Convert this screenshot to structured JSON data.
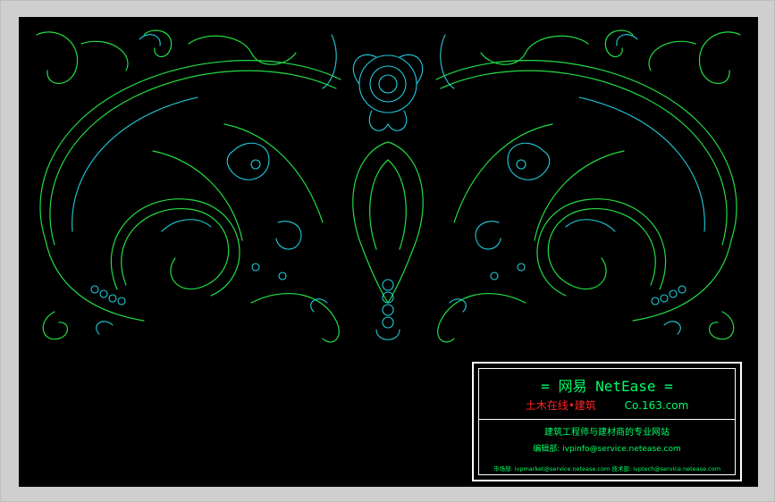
{
  "title_block": {
    "line1": "=  网易 NetEase  =",
    "line2_red": "土木在线•建筑",
    "line2_green": "Co.163.com",
    "line3": "建筑工程师与建材商的专业网站",
    "line4": "编辑部: ivpinfo@service.netease.com",
    "line5": "市场部: ivpmarket@service.netease.com   技术部: ivptech@service.netease.com"
  },
  "colors": {
    "background": "#000000",
    "line_green": "#22dd44",
    "line_cyan": "#22ccdd",
    "frame": "#ffffff"
  },
  "icons": [
    "carved-floral-ornament"
  ]
}
